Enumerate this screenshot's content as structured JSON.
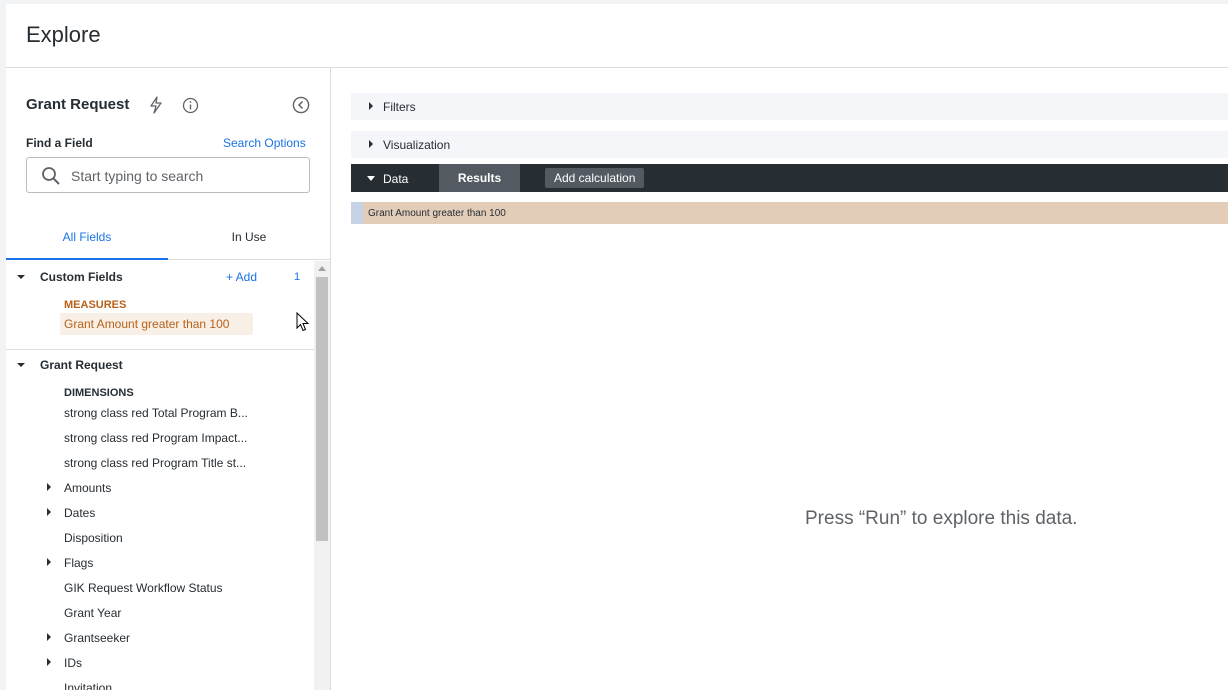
{
  "header": {
    "title": "Explore"
  },
  "sidebar": {
    "explore_name": "Grant Request",
    "find_label": "Find a Field",
    "search_options": "Search Options",
    "search_placeholder": "Start typing to search",
    "tabs": [
      {
        "label": "All Fields",
        "active": true
      },
      {
        "label": "In Use",
        "active": false
      }
    ],
    "custom_fields": {
      "label": "Custom Fields",
      "add_label": "+ Add",
      "count": "1",
      "measures_label": "MEASURES",
      "measures": [
        "Grant Amount greater than 100"
      ]
    },
    "grant_request": {
      "label": "Grant Request",
      "dimensions_label": "DIMENSIONS",
      "fields": [
        {
          "label": "strong class red Total Program B...",
          "group": false
        },
        {
          "label": "strong class red Program Impact...",
          "group": false
        },
        {
          "label": "strong class red Program Title st...",
          "group": false
        },
        {
          "label": "Amounts",
          "group": true
        },
        {
          "label": "Dates",
          "group": true
        },
        {
          "label": "Disposition",
          "group": false
        },
        {
          "label": "Flags",
          "group": true
        },
        {
          "label": "GIK Request Workflow Status",
          "group": false
        },
        {
          "label": "Grant Year",
          "group": false
        },
        {
          "label": "Grantseeker",
          "group": true
        },
        {
          "label": "IDs",
          "group": true
        },
        {
          "label": "Invitation",
          "group": false
        }
      ]
    }
  },
  "main": {
    "filters_label": "Filters",
    "visualization_label": "Visualization",
    "data_label": "Data",
    "results_label": "Results",
    "add_calc_label": "Add calculation",
    "column_header": "Grant Amount greater than 100",
    "empty_message": "Press “Run” to explore this data."
  },
  "colors": {
    "accent": "#1a73e8",
    "measure": "#b8621b",
    "dark_bar": "#262d33"
  }
}
